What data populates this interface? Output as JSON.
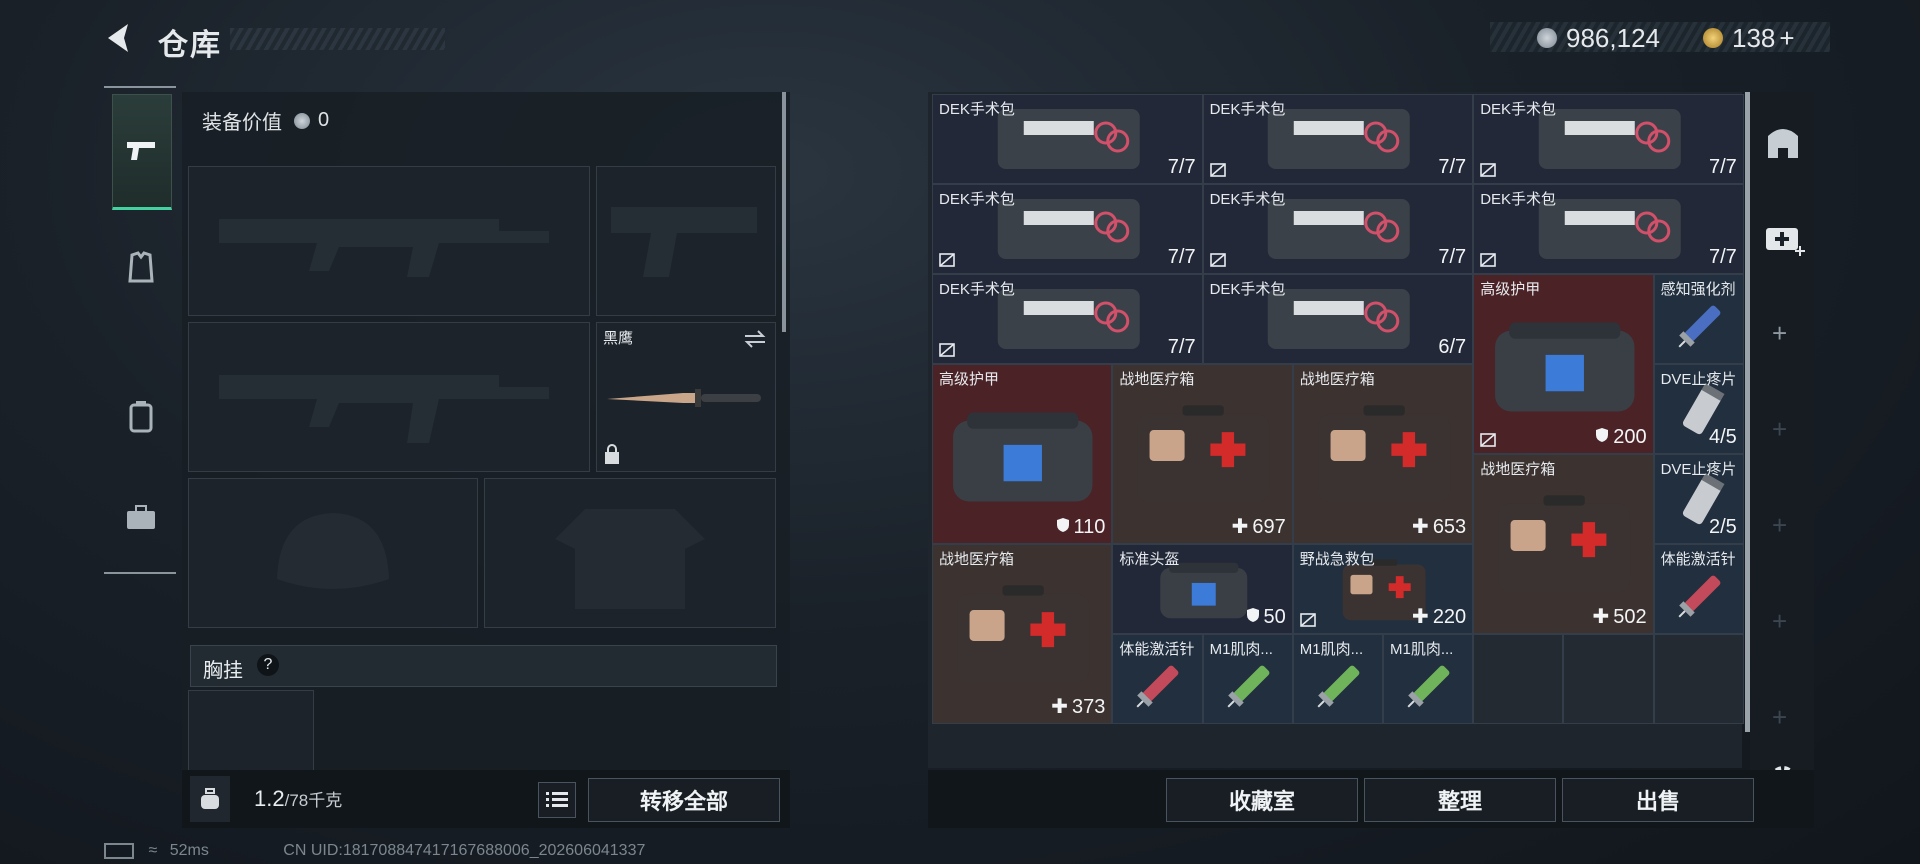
{
  "header": {
    "title": "仓库",
    "currency1": "986,124",
    "currency2": "138",
    "plus": "+"
  },
  "left": {
    "equip_value_label": "装备价值",
    "equip_value": "0",
    "knife_name": "黑鹰",
    "chest_label": "胸挂",
    "help": "?",
    "weight": "1.2",
    "weight_max": "/78千克",
    "transfer_all": "转移全部"
  },
  "grid": {
    "cells": [
      {
        "name": "DEK手术包",
        "count": "7/7"
      },
      {
        "name": "DEK手术包",
        "count": "7/7"
      },
      {
        "name": "DEK手术包",
        "count": "7/7"
      },
      {
        "name": "DEK手术包",
        "count": "7/7"
      },
      {
        "name": "DEK手术包",
        "count": "7/7"
      },
      {
        "name": "DEK手术包",
        "count": "7/7"
      },
      {
        "name": "DEK手术包",
        "count": "7/7"
      },
      {
        "name": "DEK手术包",
        "count": "6/7"
      },
      {
        "name": "高级护甲",
        "count": "200"
      },
      {
        "name": "感知强化剂",
        "count": ""
      },
      {
        "name": "高级护甲",
        "count": "110"
      },
      {
        "name": "战地医疗箱",
        "count": "697"
      },
      {
        "name": "战地医疗箱",
        "count": "653"
      },
      {
        "name": "DVE止疼片",
        "count": "4/5"
      },
      {
        "name": "战地医疗箱",
        "count": "502"
      },
      {
        "name": "DVE止疼片",
        "count": "2/5"
      },
      {
        "name": "战地医疗箱",
        "count": "373"
      },
      {
        "name": "标准头盔",
        "count": "50"
      },
      {
        "name": "野战急救包",
        "count": "220"
      },
      {
        "name": "体能激活针",
        "count": ""
      },
      {
        "name": "体能激活针",
        "count": ""
      },
      {
        "name": "M1肌肉...",
        "count": ""
      },
      {
        "name": "M1肌肉...",
        "count": ""
      },
      {
        "name": "M1肌肉...",
        "count": ""
      }
    ]
  },
  "buttons": {
    "collection": "收藏室",
    "sort": "整理",
    "sell": "出售"
  },
  "footer": {
    "ping": "52ms",
    "uid": "CN UID:181708847417167688006_202606041337"
  },
  "colors": {
    "accent": "#44d2a0",
    "red_tile": "#4b2226",
    "brown_tile": "#3c3230",
    "blue_tile": "#222f3e"
  }
}
